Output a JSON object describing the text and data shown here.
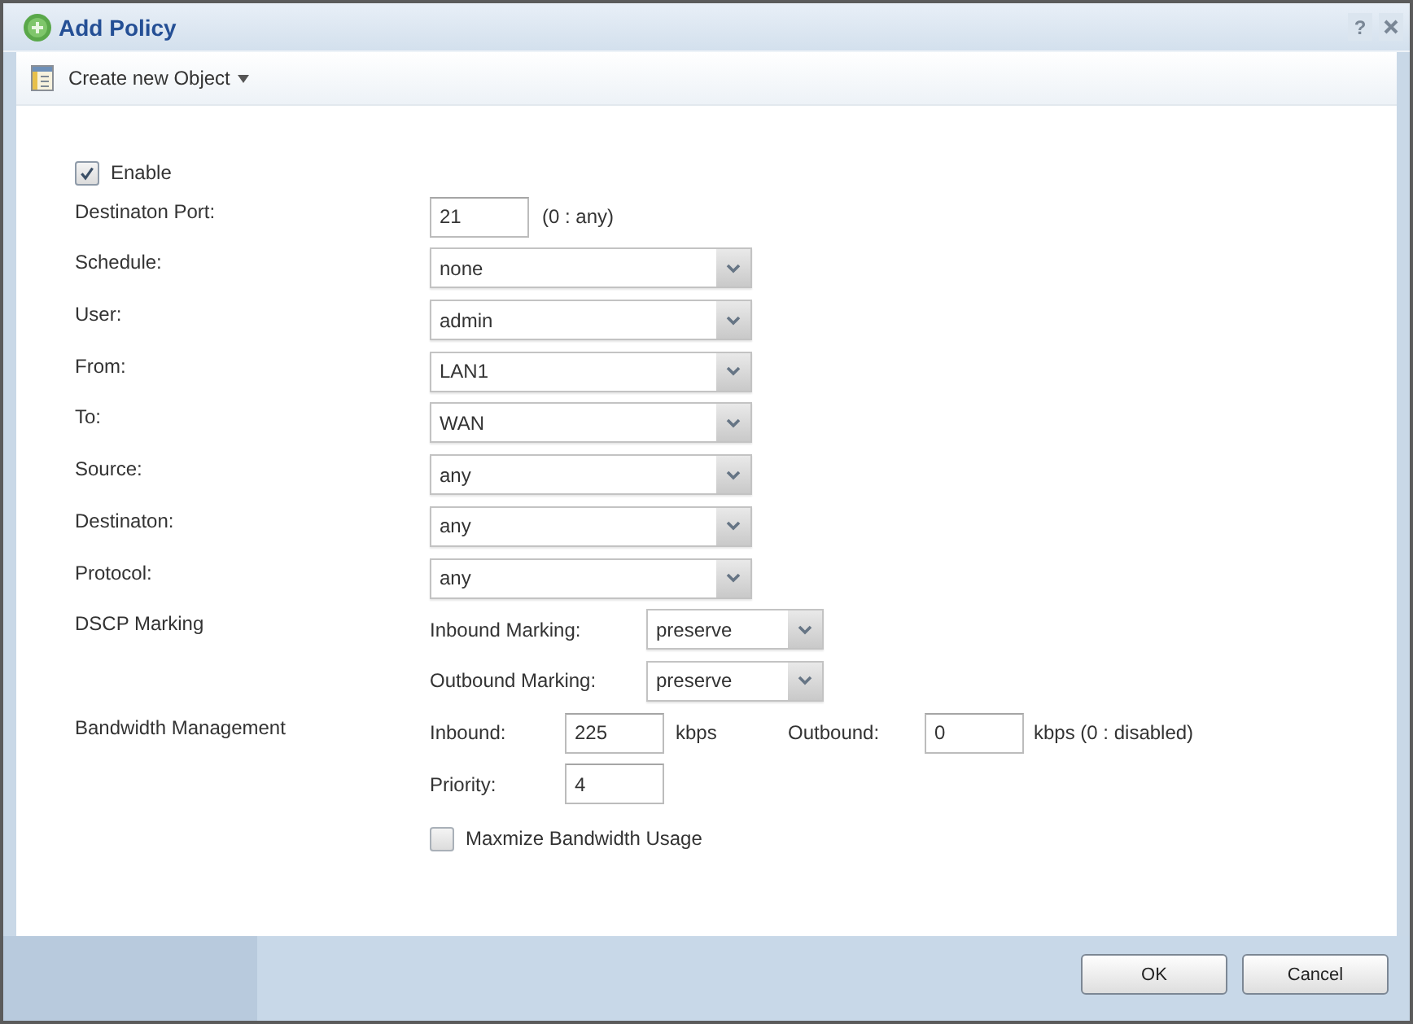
{
  "window": {
    "title": "Add Policy",
    "help": "?"
  },
  "toolbar": {
    "menu": "Create new Object"
  },
  "enable": {
    "label": "Enable",
    "checked": true
  },
  "fields": [
    {
      "kind": "text",
      "label": "Destinaton Port:",
      "value": "21",
      "hint": "(0 : any)"
    },
    {
      "kind": "select",
      "label": "Schedule:",
      "value": "none"
    },
    {
      "kind": "select",
      "label": "User:",
      "value": "admin"
    },
    {
      "kind": "select",
      "label": "From:",
      "value": "LAN1"
    },
    {
      "kind": "select",
      "label": "To:",
      "value": "WAN"
    },
    {
      "kind": "select",
      "label": "Source:",
      "value": "any"
    },
    {
      "kind": "select",
      "label": "Destinaton:",
      "value": "any"
    },
    {
      "kind": "select",
      "label": "Protocol:",
      "value": "any"
    }
  ],
  "dscp_marking": {
    "label": "DSCP Marking",
    "rows": [
      {
        "label": "Inbound Marking:",
        "value": "preserve"
      },
      {
        "label": "Outbound Marking:",
        "value": "preserve"
      }
    ]
  },
  "bandwidth_management": {
    "label": "Bandwidth Management",
    "inbound": {
      "label": "Inbound:",
      "value": "225",
      "unit": "kbps"
    },
    "outbound": {
      "label": "Outbound:",
      "value": "0",
      "unit": "kbps (0 : disabled)"
    },
    "priority": {
      "label": "Priority:",
      "value": "4"
    },
    "maximize": {
      "label": "Maxmize Bandwidth Usage",
      "checked": false
    }
  },
  "buttons": [
    {
      "label": "OK"
    },
    {
      "label": "Cancel"
    }
  ]
}
